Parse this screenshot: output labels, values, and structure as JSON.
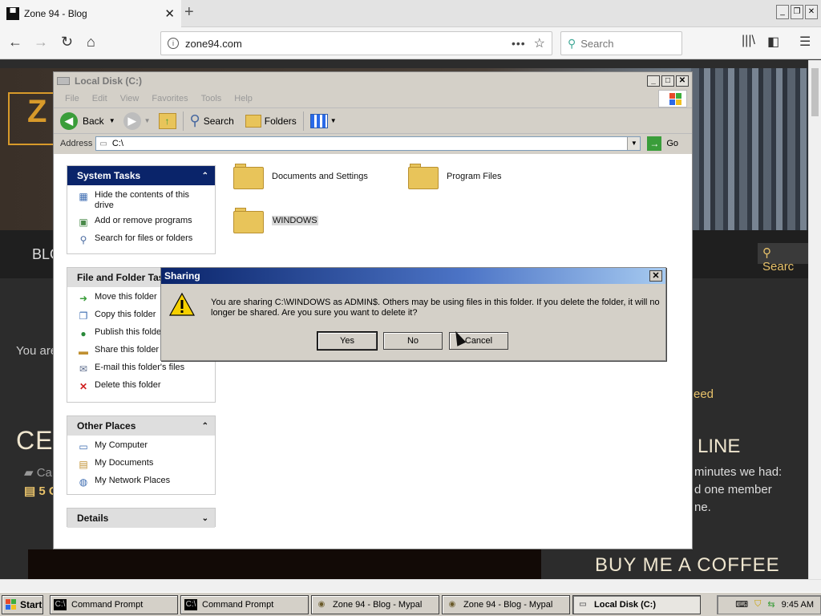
{
  "browser": {
    "tab_title": "Zone 94 - Blog",
    "url": "zone94.com",
    "search_placeholder": "Search"
  },
  "webpage": {
    "nav_blog": "BLO",
    "search_label": "Searc",
    "you_are": "You are",
    "feed": "eed",
    "headline_left": "CELI",
    "headline_right": "LINE",
    "category": "Ca",
    "comments": "5 C",
    "snippet_line1": "minutes we had:",
    "snippet_line2": "d one member",
    "snippet_line3": "ne.",
    "buy_coffee": "BUY ME A COFFEE"
  },
  "explorer": {
    "title": "Local Disk (C:)",
    "menu": [
      "File",
      "Edit",
      "View",
      "Favorites",
      "Tools",
      "Help"
    ],
    "toolbar": {
      "back": "Back",
      "search": "Search",
      "folders": "Folders"
    },
    "address_label": "Address",
    "address_value": "C:\\",
    "go_label": "Go",
    "system_tasks": {
      "title": "System Tasks",
      "items": [
        "Hide the contents of this drive",
        "Add or remove programs",
        "Search for files or folders"
      ]
    },
    "file_folder_tasks": {
      "title": "File and Folder Tas",
      "items": [
        "Move this folder",
        "Copy this folder",
        "Publish this folde Web",
        "Share this folder",
        "E-mail this folder's files",
        "Delete this folder"
      ]
    },
    "other_places": {
      "title": "Other Places",
      "items": [
        "My Computer",
        "My Documents",
        "My Network Places"
      ]
    },
    "details": {
      "title": "Details"
    },
    "folders": [
      "Documents and Settings",
      "Program Files",
      "WINDOWS"
    ]
  },
  "dialog": {
    "title": "Sharing",
    "message": "You are sharing C:\\WINDOWS as ADMIN$. Others may be using files in this folder. If you delete the folder, it will no longer be shared. Are you sure you want to delete it?",
    "yes": "Yes",
    "no": "No",
    "cancel": "Cancel"
  },
  "taskbar": {
    "start": "Start",
    "tasks": [
      "Command Prompt",
      "Command Prompt",
      "Zone 94 - Blog - Mypal",
      "Zone 94 - Blog - Mypal",
      "Local Disk (C:)"
    ],
    "clock": "9:45 AM"
  }
}
